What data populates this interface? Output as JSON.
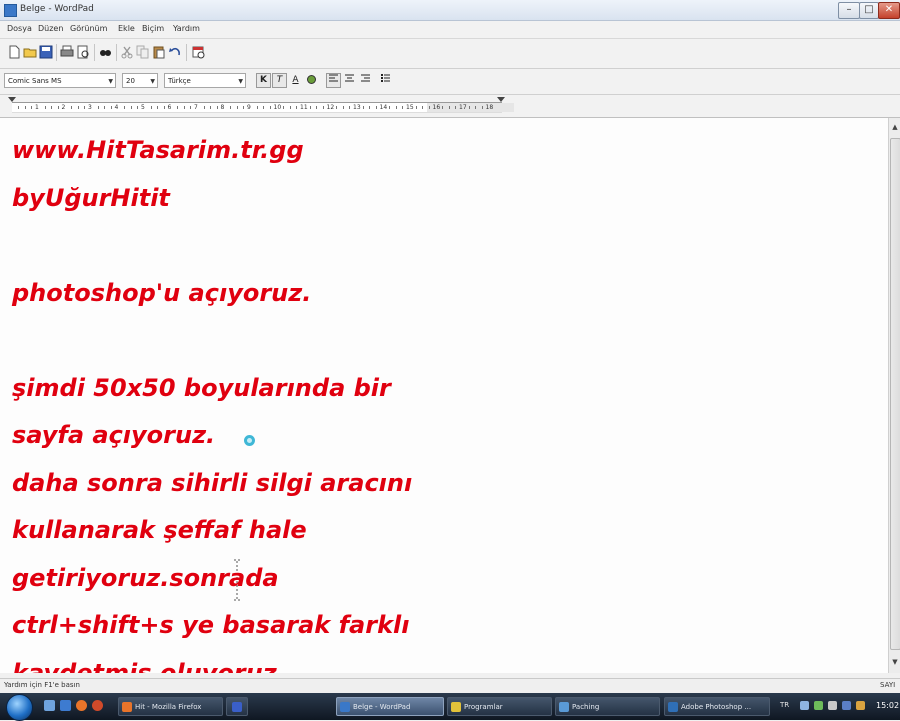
{
  "window": {
    "title": "Belge - WordPad"
  },
  "menu": [
    "Dosya",
    "Düzen",
    "Görünüm",
    "Ekle",
    "Biçim",
    "Yardım"
  ],
  "toolbar": {
    "buttons": [
      "new-icon",
      "open-icon",
      "save-icon",
      "print-icon",
      "print-preview-icon",
      "find-icon",
      "cut-icon",
      "copy-icon",
      "paste-icon",
      "undo-icon",
      "insert-datetime-icon"
    ]
  },
  "format": {
    "font": "Comic Sans MS",
    "size": "20",
    "script": "Türkçe",
    "bold_label": "K",
    "italic_label": "T",
    "underline_label": "A"
  },
  "ruler": {
    "labels": [
      "1",
      "2",
      "3",
      "4",
      "5",
      "6",
      "7",
      "8",
      "9",
      "10",
      "11",
      "12",
      "13",
      "14",
      "15",
      "16",
      "17",
      "18"
    ]
  },
  "document": {
    "lines": [
      "www.HitTasarim.tr.gg",
      "byUğurHitit",
      "",
      "photoshop'u açıyoruz.",
      "",
      "şimdi 50x50 boyularında bir",
      "sayfa açıyoruz.",
      "daha sonra sihirli silgi aracını",
      "kullanarak şeffaf hale",
      "getiriyoruz.sonrada",
      "ctrl+shift+s ye basarak farklı",
      "kaydetmiş oluyoruz."
    ],
    "text_color": "#e0000f"
  },
  "status": {
    "help": "Yardım için F1'e basın",
    "right": "SAYI"
  },
  "taskbar": {
    "tasks": [
      {
        "label": "Hit - Mozilla Firefox",
        "color": "#e8742a",
        "active": false
      },
      {
        "label": "",
        "color": "#3a5fc8",
        "active": false
      },
      {
        "label": "Belge - WordPad",
        "color": "#3a78c8",
        "active": true
      },
      {
        "label": "Programlar",
        "color": "#e2c23a",
        "active": false
      },
      {
        "label": "Paching",
        "color": "#5a9ad6",
        "active": false
      },
      {
        "label": "Adobe Photoshop ...",
        "color": "#2f6fb6",
        "active": false
      }
    ],
    "lang": "TR",
    "clock": "15:02"
  }
}
